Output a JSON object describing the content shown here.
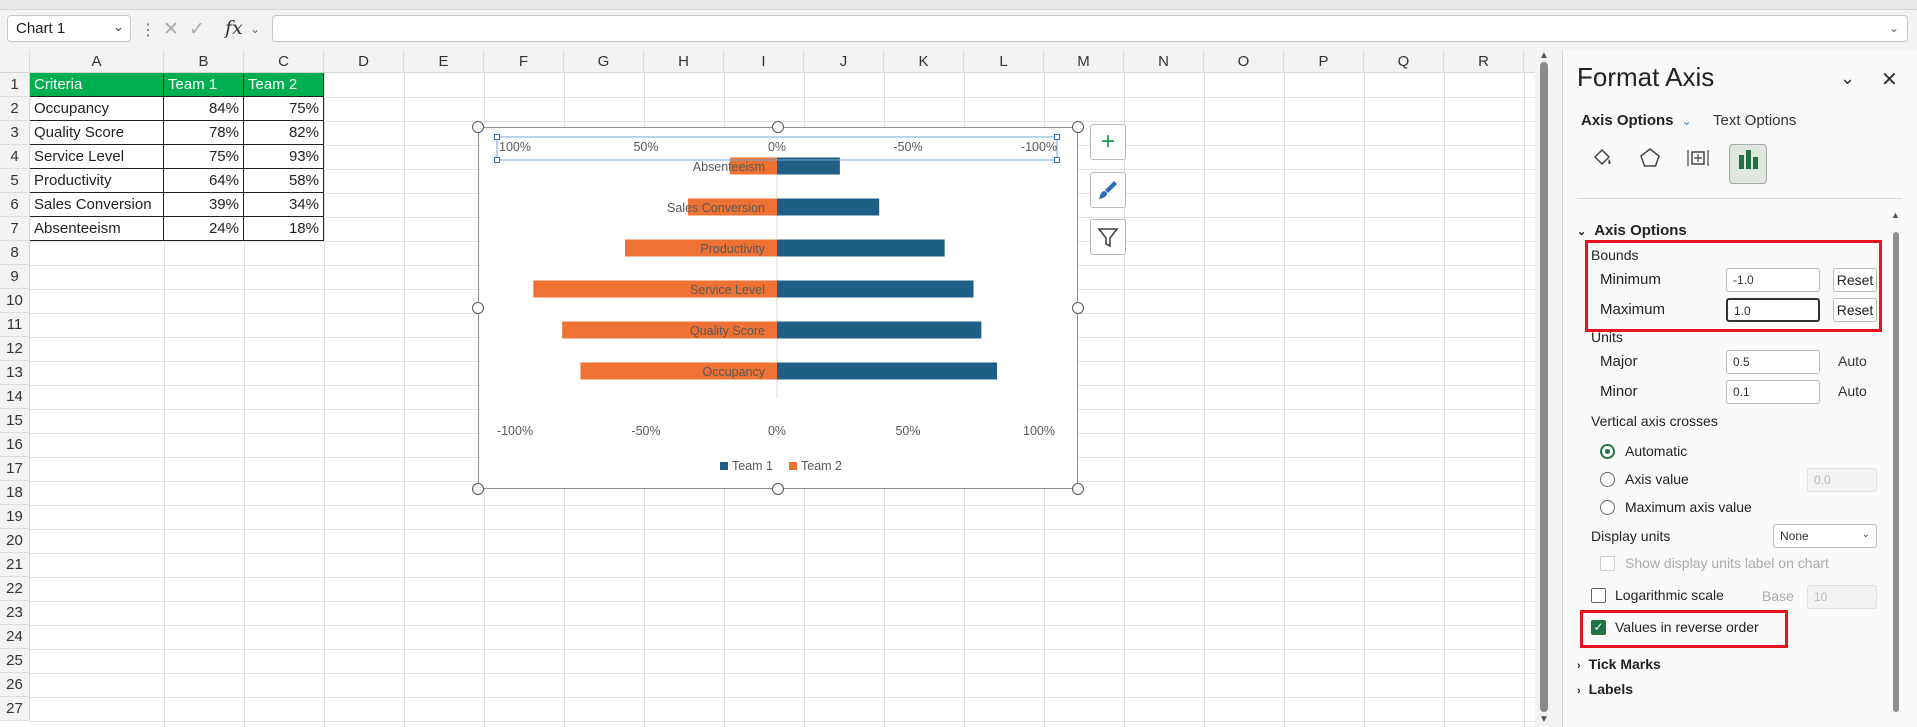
{
  "formula_bar": {
    "name_box": "Chart 1",
    "fx": "fx",
    "formula": ""
  },
  "grid": {
    "columns": [
      "A",
      "B",
      "C",
      "D",
      "E",
      "F",
      "G",
      "H",
      "I",
      "J",
      "K",
      "L",
      "M",
      "N",
      "O",
      "P",
      "Q",
      "R"
    ],
    "rows": [
      "1",
      "2",
      "3",
      "4",
      "5",
      "6",
      "7",
      "8",
      "9",
      "10",
      "11",
      "12",
      "13",
      "14",
      "15",
      "16",
      "17",
      "18",
      "19",
      "20",
      "21",
      "22",
      "23",
      "24",
      "25",
      "26",
      "27"
    ],
    "table": {
      "headers": [
        "Criteria",
        "Team 1",
        "Team 2"
      ],
      "rows": [
        [
          "Occupancy",
          "84%",
          "75%"
        ],
        [
          "Quality Score",
          "78%",
          "82%"
        ],
        [
          "Service Level",
          "75%",
          "93%"
        ],
        [
          "Productivity",
          "64%",
          "58%"
        ],
        [
          "Sales Conversion",
          "39%",
          "34%"
        ],
        [
          "Absenteeism",
          "24%",
          "18%"
        ]
      ]
    }
  },
  "chart_data": {
    "type": "bar",
    "orientation": "horizontal",
    "categories": [
      "Occupancy",
      "Quality Score",
      "Service Level",
      "Productivity",
      "Sales Conversion",
      "Absenteeism"
    ],
    "series": [
      {
        "name": "Team 1",
        "values": [
          0.84,
          0.78,
          0.75,
          0.64,
          0.39,
          0.24
        ],
        "color": "#1f5f86"
      },
      {
        "name": "Team 2",
        "values": [
          -0.75,
          -0.82,
          -0.93,
          -0.58,
          -0.34,
          -0.18
        ],
        "color": "#ed7233"
      }
    ],
    "xlim": [
      -1,
      1
    ],
    "bottom_axis_ticks": [
      "-100%",
      "-50%",
      "0%",
      "50%",
      "100%"
    ],
    "top_axis_ticks": [
      "100%",
      "50%",
      "0%",
      "-50%",
      "-100%"
    ],
    "top_axis_reversed": true,
    "legend": "bottom",
    "grid": false
  },
  "chart_tools": {
    "add": "+",
    "styles": "brush-icon",
    "filter": "filter-icon"
  },
  "pane": {
    "title": "Format Axis",
    "tab_axis_options": "Axis Options",
    "tab_text_options": "Text Options",
    "section_axis_options": "Axis Options",
    "bounds_label": "Bounds",
    "minimum_label": "Minimum",
    "minimum_value": "-1.0",
    "maximum_label": "Maximum",
    "maximum_value": "1.0",
    "reset": "Reset",
    "units_label": "Units",
    "major_label": "Major",
    "major_value": "0.5",
    "minor_label": "Minor",
    "minor_value": "0.1",
    "auto": "Auto",
    "vertical_axis_crosses": "Vertical axis crosses",
    "automatic": "Automatic",
    "axis_value": "Axis value",
    "axis_value_input": "0.0",
    "maximum_axis_value": "Maximum axis value",
    "display_units": "Display units",
    "display_units_value": "None",
    "show_units_label": "Show display units label on chart",
    "log_scale": "Logarithmic scale",
    "base_label": "Base",
    "base_value": "10",
    "reverse_order": "Values in reverse order",
    "tick_marks": "Tick Marks",
    "labels": "Labels"
  }
}
